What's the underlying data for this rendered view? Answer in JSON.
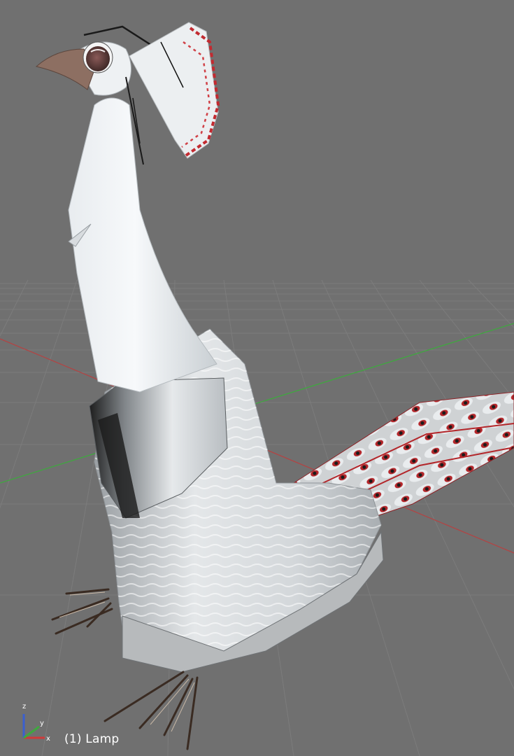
{
  "viewport": {
    "object_label": "(1) Lamp",
    "axis_labels": {
      "x": "x",
      "y": "y",
      "z": "z"
    },
    "colors": {
      "background": "#707070",
      "grid": "#7c7c7c",
      "x_axis": "#b04545",
      "y_axis": "#3fa83f",
      "z_axis": "#3a5fd0",
      "text": "#ffffff"
    },
    "model": "white-peacock",
    "grid": true
  }
}
